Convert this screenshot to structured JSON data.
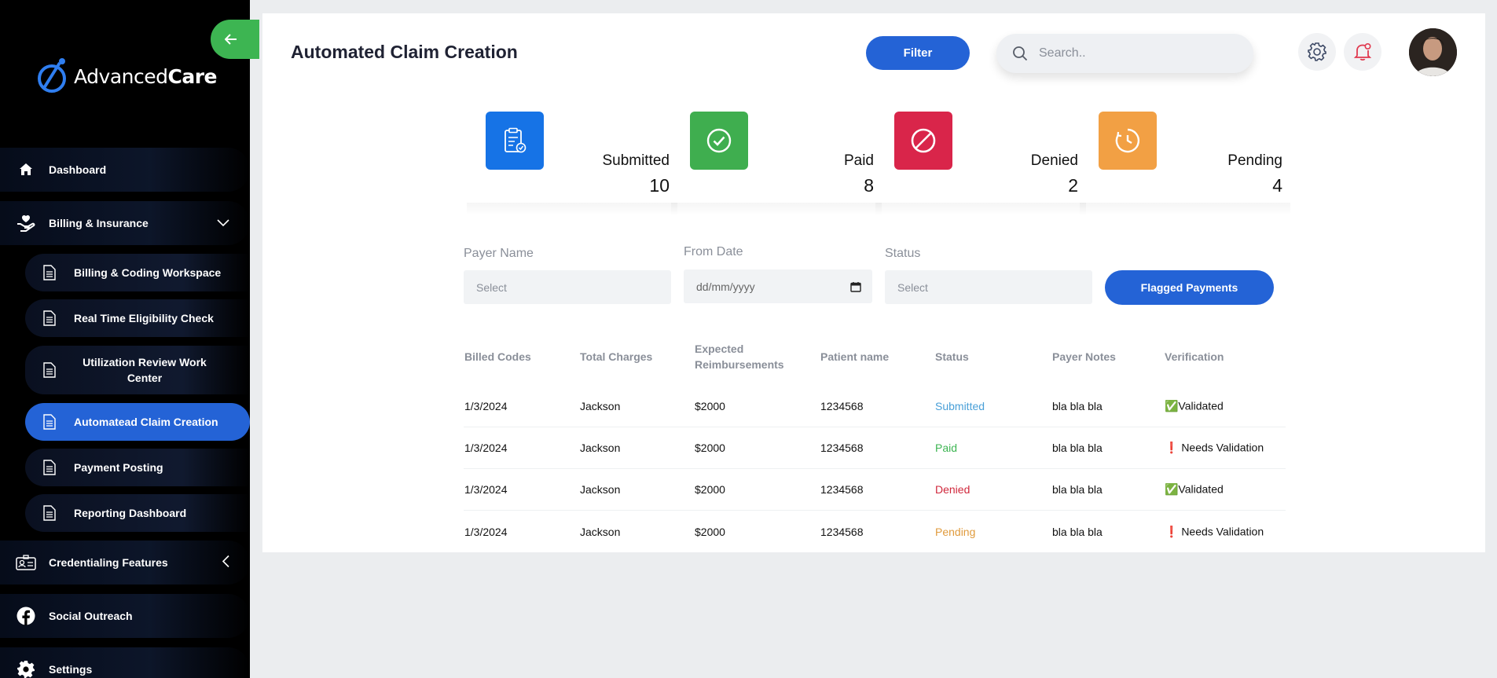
{
  "brand": {
    "name_regular": "Advanced",
    "name_bold": "Care"
  },
  "sidebar": {
    "items": [
      {
        "label": "Dashboard",
        "icon": "home-icon"
      },
      {
        "label": "Billing & Insurance",
        "icon": "hand-heart-icon",
        "expanded": true,
        "children": [
          {
            "label": "Billing & Coding Workspace",
            "icon": "document-icon"
          },
          {
            "label": "Real Time Eligibility Check",
            "icon": "document-icon"
          },
          {
            "label": "Utilization Review Work Center",
            "icon": "document-icon"
          },
          {
            "label": "Automatead Claim Creation",
            "icon": "document-icon",
            "active": true
          },
          {
            "label": "Payment Posting",
            "icon": "document-icon"
          },
          {
            "label": "Reporting Dashboard",
            "icon": "document-icon"
          }
        ]
      },
      {
        "label": "Credentialing Features",
        "icon": "id-card-icon"
      },
      {
        "label": "Social Outreach",
        "icon": "facebook-icon"
      },
      {
        "label": "Settings",
        "icon": "gear-icon"
      }
    ]
  },
  "header": {
    "title": "Automated Claim Creation",
    "filter_label": "Filter",
    "search_placeholder": "Search.."
  },
  "stats": [
    {
      "label": "Submitted",
      "value": "10",
      "color": "#1673e6",
      "icon": "clipboard-check-icon"
    },
    {
      "label": "Paid",
      "value": "8",
      "color": "#3fae4f",
      "icon": "check-circle-icon"
    },
    {
      "label": "Denied",
      "value": "2",
      "color": "#d9254a",
      "icon": "ban-icon"
    },
    {
      "label": "Pending",
      "value": "4",
      "color": "#f2a044",
      "icon": "clock-icon"
    }
  ],
  "filters": {
    "payer_label": "Payer Name",
    "payer_placeholder": "Select",
    "from_date_label": "From Date",
    "from_date_placeholder": "dd/mm/yyyy",
    "status_label": "Status",
    "status_placeholder": "Select",
    "flagged_label": "Flagged Payments"
  },
  "table": {
    "headers": [
      "Billed Codes",
      "Total Charges",
      "Expected Reimbursements",
      "Patient name",
      "Status",
      "Payer Notes",
      "Verification"
    ],
    "rows": [
      {
        "billed_codes": "1/3/2024",
        "total_charges": "Jackson",
        "expected": "$2000",
        "patient": "1234568",
        "status": "Submitted",
        "notes": "bla bla bla",
        "verification": "✅Validated"
      },
      {
        "billed_codes": "1/3/2024",
        "total_charges": "Jackson",
        "expected": "$2000",
        "patient": "1234568",
        "status": "Paid",
        "notes": "bla bla bla",
        "verification": "❗ Needs Validation"
      },
      {
        "billed_codes": "1/3/2024",
        "total_charges": "Jackson",
        "expected": "$2000",
        "patient": "1234568",
        "status": "Denied",
        "notes": "bla bla bla",
        "verification": "✅Validated"
      },
      {
        "billed_codes": "1/3/2024",
        "total_charges": "Jackson",
        "expected": "$2000",
        "patient": "1234568",
        "status": "Pending",
        "notes": "bla bla bla",
        "verification": "❗ Needs Validation"
      }
    ]
  }
}
